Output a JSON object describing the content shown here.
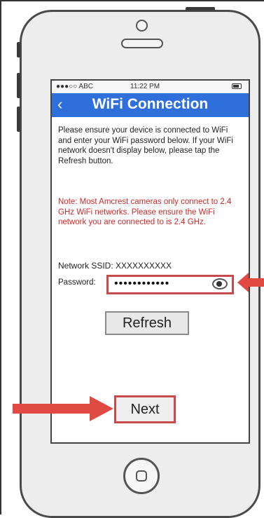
{
  "status_bar": {
    "carrier": "●●●○○ ABC",
    "time": "11:22 PM"
  },
  "header": {
    "title": "WiFi Connection"
  },
  "instructions": "Please ensure your device is connected to WiFi and enter your WiFi password below. If your WiFi network doesn't display below, please tap the Refresh button.",
  "note": "Note: Most Amcrest cameras only connect to 2.4 GHz WiFi networks. Please ensure the WiFi network you are connected to is 2.4 GHz.",
  "network": {
    "ssid_label": "Network SSID: XXXXXXXXXX"
  },
  "password": {
    "label": "Password:",
    "value": "••••••••••••"
  },
  "buttons": {
    "refresh": "Refresh",
    "next": "Next"
  },
  "colors": {
    "accent": "#2f6fdc",
    "highlight": "#c94a4a",
    "note_text": "#d02828",
    "arrow": "#e04a43"
  }
}
